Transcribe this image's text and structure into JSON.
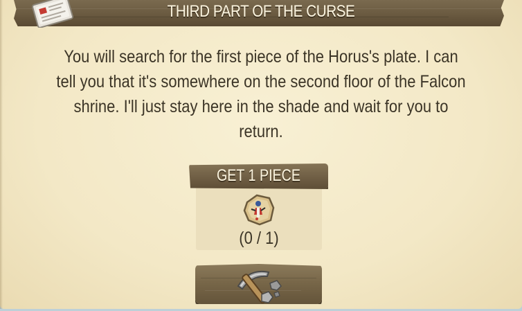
{
  "dialog": {
    "title": "THIRD PART OF THE CURSE",
    "title_icon": "quest-scroll-icon",
    "description": "You will search for the first piece of the Horus's plate. I can tell you that it's somewhere on the second floor of the Falcon shrine. I'll just stay here in the shade and wait for you to return."
  },
  "objective": {
    "label": "GET 1 PIECE",
    "item_icon": "horus-plate-piece-icon",
    "progress": "(0 / 1)",
    "collected": 0,
    "required": 1
  },
  "action_button": {
    "icon": "pickaxe-icon"
  },
  "colors": {
    "panel_background": "#f3e8c6",
    "plank_wood": "#6d5d43",
    "plank_text": "#fbf4df",
    "body_text": "#3b3426",
    "card_background": "#ebdfbd"
  }
}
